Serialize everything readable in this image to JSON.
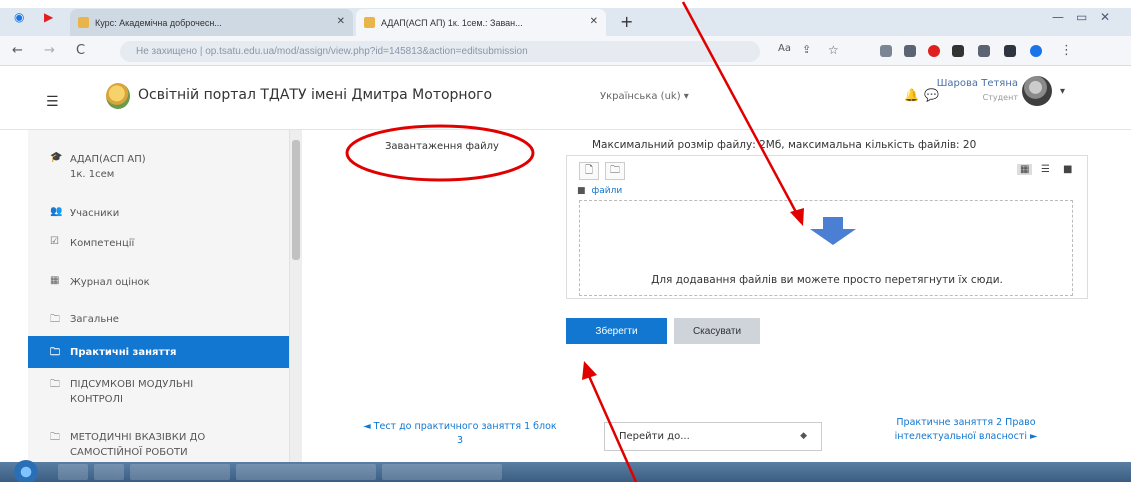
{
  "browser": {
    "tabs": [
      {
        "title": "Курс: Академічна доброчесн..."
      },
      {
        "title": "АДАП(АСП АП) 1к. 1сем.: Заван..."
      }
    ],
    "address": "Не захищено | op.tsatu.edu.ua/mod/assign/view.php?id=145813&action=editsubmission"
  },
  "header": {
    "portal_title": "Освітній портал ТДАТУ імені Дмитра Моторного",
    "language": "Українська (uk) ▾",
    "user_name": "Шарова Тетяна",
    "user_role": "Студент"
  },
  "sidebar": {
    "items": [
      {
        "icon": "graduation-cap-icon",
        "glyph": "🎓",
        "label": "АДАП(АСП АП) 1к. 1сем"
      },
      {
        "icon": "users-icon",
        "glyph": "👥",
        "label": "Учасники"
      },
      {
        "icon": "competency-icon",
        "glyph": "☑",
        "label": "Компетенції"
      },
      {
        "icon": "grades-table-icon",
        "glyph": "▦",
        "label": "Журнал оцінок"
      },
      {
        "icon": "folder-icon",
        "glyph": "🗀",
        "label": "Загальне"
      },
      {
        "icon": "folder-icon",
        "glyph": "🗀",
        "label": "Практичні заняття"
      },
      {
        "icon": "folder-icon",
        "glyph": "🗀",
        "label": "ПІДСУМКОВІ МОДУЛЬНІ КОНТРОЛІ"
      },
      {
        "icon": "folder-icon",
        "glyph": "🗀",
        "label": "МЕТОДИЧНІ ВКАЗІВКИ ДО САМОСТІЙНОЇ РОБОТИ"
      }
    ]
  },
  "main": {
    "file_label": "Завантаження файлу",
    "max_size_text": "Максимальний розмір файлу: 2Мб, максимальна кількість файлів: 20",
    "files_folder_label": "файли",
    "drop_text": "Для додавання файлів ви можете просто перетягнути їх сюди.",
    "save_label": "Зберегти",
    "cancel_label": "Скасувати",
    "prev_link": "◄ Тест до практичного заняття 1 блок 3",
    "jump_placeholder": "Перейти до...",
    "next_link": "Практичне заняття 2 Право інтелектуальної власності ►"
  },
  "colors": {
    "accent": "#1177d1",
    "annotation": "#e00000"
  }
}
